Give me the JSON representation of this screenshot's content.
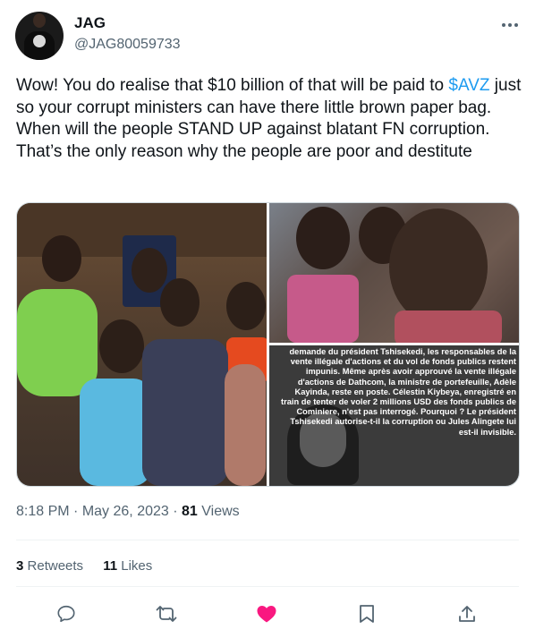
{
  "author": {
    "display_name": "JAG",
    "handle": "@JAG80059733",
    "avatar_icon": "avatar-photo"
  },
  "tweet": {
    "line1_prefix": "Wow! You do realise that $10 billion of that will be paid to ",
    "cashtag": "$AVZ",
    "line1_suffix": " just so your corrupt ministers can have there little brown paper bag.",
    "line2": "When will the people STAND UP against blatant FN corruption.",
    "line3": "That’s the only reason why the people are poor and destitute"
  },
  "media": {
    "image3_text": "demande du président Tshisekedi, les responsables de la vente illégale d'actions et du vol de fonds publics restent impunis. Même après avoir approuvé la vente illégale d'actions de Dathcom, la ministre de portefeuille, Adèle Kayinda, reste en poste. Célestin Kiybeya, enregistré en train de tenter de voler 2 millions USD des fonds publics de Cominiere, n'est pas interrogé. Pourquoi ? Le président Tshisekedi autorise-t-il la corruption ou Jules Alingete lui est-il invisible."
  },
  "meta": {
    "time": "8:18 PM",
    "sep": "·",
    "date": "May 26, 2023",
    "views_count": "81",
    "views_label": "Views"
  },
  "stats": {
    "retweets_count": "3",
    "retweets_label": "Retweets",
    "likes_count": "11",
    "likes_label": "Likes"
  },
  "colors": {
    "accent": "#1d9bf0",
    "like": "#f91880",
    "muted": "#536471"
  }
}
